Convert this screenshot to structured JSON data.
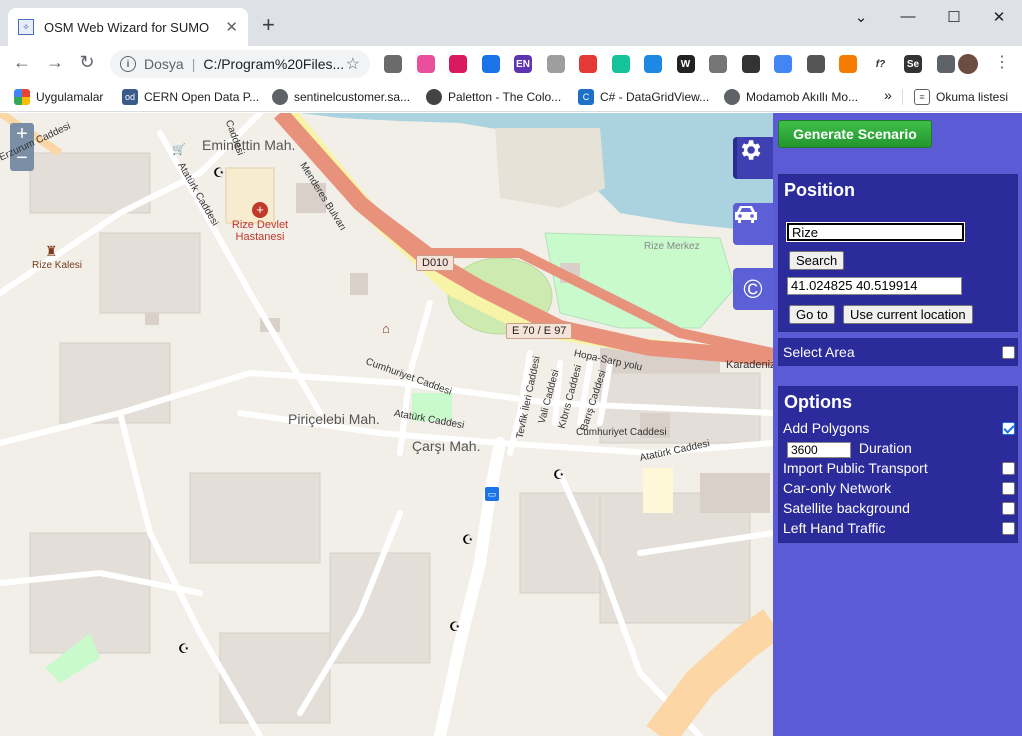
{
  "browser": {
    "tab_title": "OSM Web Wizard for SUMO",
    "tab_close": "✕",
    "new_tab": "+",
    "window_controls": {
      "minimize": "—",
      "maximize": "☐",
      "close": "✕"
    },
    "url_scheme": "Dosya",
    "url": "C:/Program%20Files...",
    "bookmarks": [
      {
        "label": "Uygulamalar",
        "icon": "apps-grid-icon",
        "color": "#ea4335"
      },
      {
        "label": "CERN Open Data P...",
        "icon": "od-icon",
        "color": "#3a5a8c"
      },
      {
        "label": "sentinelcustomer.sa...",
        "icon": "globe-icon",
        "color": "#5f6368"
      },
      {
        "label": "Paletton - The Colo...",
        "icon": "paletton-icon",
        "color": "#444"
      },
      {
        "label": "C# - DataGridView...",
        "icon": "csharp-icon",
        "color": "#1e6fc7"
      },
      {
        "label": "Modamob Akıllı Mo...",
        "icon": "globe-icon",
        "color": "#5f6368"
      }
    ],
    "bookmarks_overflow": "»",
    "reading_list": "Okuma listesi",
    "extensions": [
      {
        "icon": "ext-1",
        "color": "#6b6b6b"
      },
      {
        "icon": "ext-2",
        "color": "#e94f9a"
      },
      {
        "icon": "power-icon",
        "color": "#d81b60"
      },
      {
        "icon": "ext-4",
        "color": "#1a73e8"
      },
      {
        "icon": "en-icon",
        "color": "#5e35b1"
      },
      {
        "icon": "ext-6",
        "color": "#9e9e9e"
      },
      {
        "icon": "stop-icon",
        "color": "#e53935"
      },
      {
        "icon": "grammarly-icon",
        "color": "#15c39a"
      },
      {
        "icon": "ext-9",
        "color": "#1e88e5"
      },
      {
        "icon": "wikipedia-icon",
        "color": "#222"
      },
      {
        "icon": "ext-11",
        "color": "#757575"
      },
      {
        "icon": "ext-12",
        "color": "#333"
      },
      {
        "icon": "translate-icon",
        "color": "#4285f4"
      },
      {
        "icon": "eyedropper-icon",
        "color": "#555"
      },
      {
        "icon": "ext-15",
        "color": "#f57c00"
      },
      {
        "icon": "ext-16",
        "color": "#333"
      },
      {
        "icon": "selenium-icon",
        "color": "#333"
      },
      {
        "icon": "puzzle-icon",
        "color": "#5f6368"
      }
    ],
    "ext_labels": {
      "en": "EN",
      "wiki": "W",
      "fx": "f?",
      "se": "Se"
    }
  },
  "map": {
    "zoom_in": "+",
    "zoom_out": "−",
    "labels": {
      "eminettin": "Eminettin Mah.",
      "hospital": "Rize Devlet Hastanesi",
      "castle": "Rize Kalesi",
      "pircelebi": "Piriçelebi Mah.",
      "carsi": "Çarşı Mah.",
      "rize_merkez": "Rize Merkez",
      "karadeniz": "Karadeniz",
      "d010": "D010",
      "e70": "E 70 / E 97",
      "hopa": "Hopa-Sarp yolu",
      "menderes": "Menderes Bulvarı",
      "ataturk1": "Atatürk Caddesi",
      "ataturk2": "Atatürk Caddesi",
      "ataturk3": "Atatürk Caddesi",
      "cumhuriyet1": "Cumhuriyet Caddesi",
      "cumhuriyet2": "Cumhuriyet Caddesi",
      "tevfik": "Tevfik İleri Caddesi",
      "vali": "Vali Caddesi",
      "kibris": "Kıbrıs Caddesi",
      "baris": "Barış Caddesi",
      "erzurum": "Erzurum Caddesi",
      "caddesi_top": "Caddesi"
    }
  },
  "panel": {
    "generate_label": "Generate Scenario",
    "position": {
      "title": "Position",
      "search_value": "Rize",
      "search_button": "Search",
      "coords_value": "41.024825 40.519914",
      "goto_button": "Go to",
      "current_location_button": "Use current location"
    },
    "select_area": {
      "label": "Select Area",
      "checked": false
    },
    "options": {
      "title": "Options",
      "add_polygons": {
        "label": "Add Polygons",
        "checked": true
      },
      "duration_value": "3600",
      "duration_label": "Duration",
      "import_pt": {
        "label": "Import Public Transport",
        "checked": false
      },
      "car_only": {
        "label": "Car-only Network",
        "checked": false
      },
      "satellite": {
        "label": "Satellite background",
        "checked": false
      },
      "left_hand": {
        "label": "Left Hand Traffic",
        "checked": false
      }
    }
  },
  "colors": {
    "panel_bg": "#5b5bd6",
    "box_bg": "#2b2b9b",
    "generate_green": "#2ea83a",
    "motorway": "#e8927c",
    "primary": "#fcd6a4",
    "sea": "#aad3df",
    "park": "#c8facc"
  }
}
